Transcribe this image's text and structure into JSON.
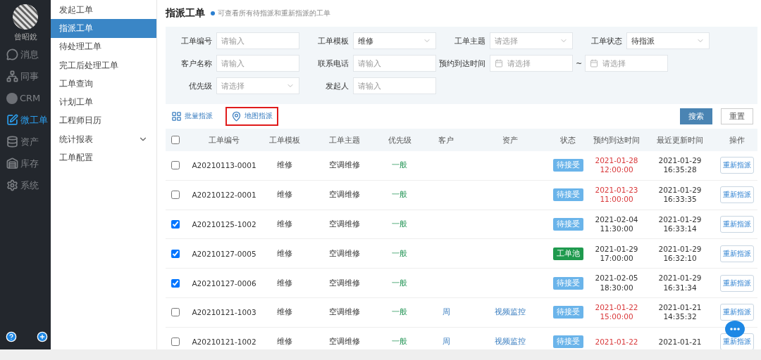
{
  "user": {
    "name": "曾昭銳"
  },
  "nav": [
    {
      "label": "消息",
      "selected": false
    },
    {
      "label": "同事",
      "selected": false
    },
    {
      "label": "CRM",
      "selected": false
    },
    {
      "label": "微工单",
      "selected": true
    },
    {
      "label": "资产",
      "selected": false
    },
    {
      "label": "库存",
      "selected": false
    },
    {
      "label": "系统",
      "selected": false
    }
  ],
  "submenu": [
    {
      "label": "发起工单",
      "selected": false,
      "expandable": false
    },
    {
      "label": "指派工单",
      "selected": true,
      "expandable": false
    },
    {
      "label": "待处理工单",
      "selected": false,
      "expandable": false
    },
    {
      "label": "完工后处理工单",
      "selected": false,
      "expandable": false
    },
    {
      "label": "工单查询",
      "selected": false,
      "expandable": false
    },
    {
      "label": "计划工单",
      "selected": false,
      "expandable": false
    },
    {
      "label": "工程师日历",
      "selected": false,
      "expandable": false
    },
    {
      "label": "统计报表",
      "selected": false,
      "expandable": true
    },
    {
      "label": "工单配置",
      "selected": false,
      "expandable": false
    }
  ],
  "page": {
    "title": "指派工单",
    "hint": "可查看所有待指派和重新指派的工单"
  },
  "filters": [
    [
      {
        "label": "工单编号",
        "kind": "input",
        "placeholder": "请输入"
      },
      {
        "label": "工单模板",
        "kind": "select",
        "value": "维修"
      },
      {
        "label": "工单主题",
        "kind": "select",
        "placeholder": "请选择"
      },
      {
        "label": "工单状态",
        "kind": "select",
        "value": "待指派"
      }
    ],
    [
      {
        "label": "客户名称",
        "kind": "input",
        "placeholder": "请输入"
      },
      {
        "label": "联系电话",
        "kind": "input",
        "placeholder": "请输入"
      },
      {
        "label": "预约到达时间",
        "kind": "daterange",
        "placeholder": "请选择",
        "separator": "~",
        "placeholder_end": "请选择"
      }
    ],
    [
      {
        "label": "优先级",
        "kind": "select",
        "placeholder": "请选择"
      },
      {
        "label": "发起人",
        "kind": "input",
        "placeholder": "请输入"
      }
    ]
  ],
  "actions": [
    {
      "label": "批量指派",
      "highlighted": false
    },
    {
      "label": "地图指派",
      "highlighted": true
    }
  ],
  "buttons": [
    {
      "label": "搜索",
      "kind": "primary"
    },
    {
      "label": "重置",
      "kind": "default"
    }
  ],
  "table": {
    "all_checked": false,
    "columns": [
      "工单编号",
      "工单模板",
      "工单主题",
      "优先级",
      "客户",
      "资产",
      "状态",
      "预约到达时间",
      "最近更新时间",
      "操作"
    ],
    "rows": [
      {
        "checked": false,
        "id": "A20210113-0001",
        "template": "维修",
        "subject": "空调维修",
        "priority": "一般",
        "status": {
          "label": "待接受",
          "color": "#6ab4ea"
        },
        "due_date": "2021-01-28",
        "due_time": "12:00:00",
        "overdue": true,
        "updated_date": "2021-01-29",
        "updated_time": "16:35:28",
        "action": "重新指派"
      },
      {
        "checked": false,
        "id": "A20210122-0001",
        "template": "维修",
        "subject": "空调维修",
        "priority": "一般",
        "status": {
          "label": "待接受",
          "color": "#6ab4ea"
        },
        "due_date": "2021-01-23",
        "due_time": "11:00:00",
        "overdue": true,
        "updated_date": "2021-01-29",
        "updated_time": "16:33:35",
        "action": "重新指派"
      },
      {
        "checked": true,
        "id": "A20210125-1002",
        "template": "维修",
        "subject": "空调维修",
        "priority": "一般",
        "status": {
          "label": "待接受",
          "color": "#6ab4ea"
        },
        "due_date": "2021-02-04",
        "due_time": "11:30:00",
        "overdue": false,
        "updated_date": "2021-01-29",
        "updated_time": "16:33:14",
        "action": "重新指派"
      },
      {
        "checked": true,
        "id": "A20210127-0005",
        "template": "维修",
        "subject": "空调维修",
        "priority": "一般",
        "status": {
          "label": "工单池",
          "color": "#1f9a4e"
        },
        "due_date": "2021-01-29",
        "due_time": "17:00:00",
        "overdue": false,
        "updated_date": "2021-01-29",
        "updated_time": "16:32:10",
        "action": "重新指派"
      },
      {
        "checked": true,
        "id": "A20210127-0006",
        "template": "维修",
        "subject": "空调维修",
        "priority": "一般",
        "status": {
          "label": "待接受",
          "color": "#6ab4ea"
        },
        "due_date": "2021-02-05",
        "due_time": "18:30:00",
        "overdue": false,
        "updated_date": "2021-01-29",
        "updated_time": "16:31:34",
        "action": "重新指派"
      },
      {
        "checked": false,
        "id": "A20210121-1003",
        "template": "维修",
        "subject": "空调维修",
        "priority": "一般",
        "customer": "周",
        "asset": "视频监控",
        "status": {
          "label": "待接受",
          "color": "#6ab4ea"
        },
        "due_date": "2021-01-22",
        "due_time": "15:00:00",
        "overdue": true,
        "updated_date": "2021-01-21",
        "updated_time": "14:35:32",
        "action": "重新指派"
      },
      {
        "checked": false,
        "id": "A20210121-1002",
        "template": "维修",
        "subject": "空调维修",
        "priority": "一般",
        "customer": "周",
        "asset": "视频监控",
        "status": {
          "label": "待接受",
          "color": "#6ab4ea"
        },
        "due_date": "2021-01-22",
        "overdue": true,
        "updated_date": "2021-01-21",
        "action": "重新指派"
      }
    ]
  }
}
